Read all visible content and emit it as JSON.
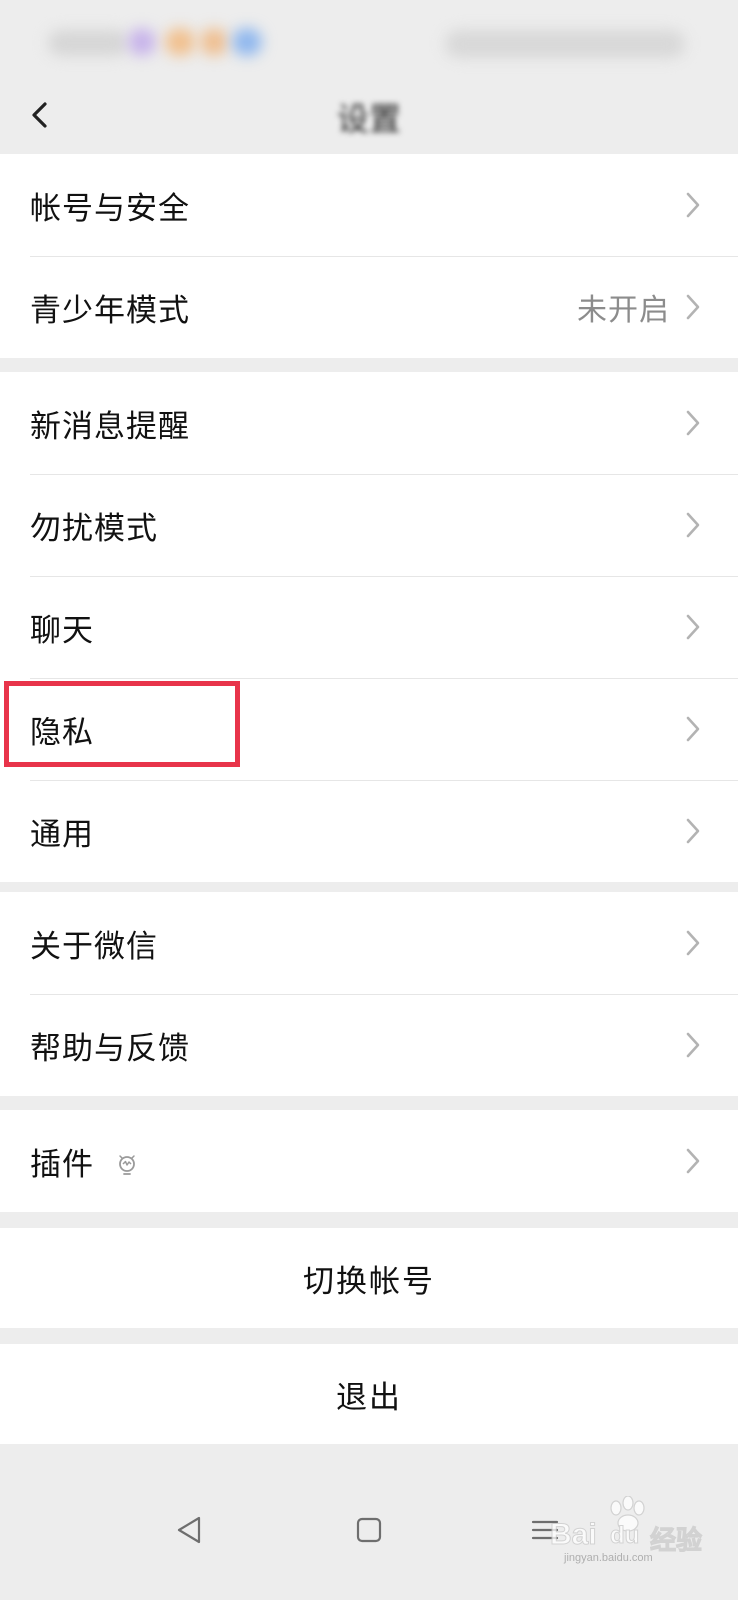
{
  "header": {
    "title": "设置"
  },
  "groups": [
    {
      "items": [
        {
          "label": "帐号与安全",
          "value": ""
        },
        {
          "label": "青少年模式",
          "value": "未开启"
        }
      ]
    },
    {
      "items": [
        {
          "label": "新消息提醒"
        },
        {
          "label": "勿扰模式"
        },
        {
          "label": "聊天"
        },
        {
          "label": "隐私"
        },
        {
          "label": "通用"
        }
      ]
    },
    {
      "items": [
        {
          "label": "关于微信"
        },
        {
          "label": "帮助与反馈"
        }
      ]
    },
    {
      "items": [
        {
          "label": "插件"
        }
      ]
    }
  ],
  "actions": {
    "switch_account": "切换帐号",
    "logout": "退出"
  },
  "highlight": {
    "color": "#e8344a"
  },
  "watermark": {
    "brand": "Bai",
    "brand_suffix": "du",
    "cn": "经验",
    "url": "jingyan.baidu.com"
  }
}
